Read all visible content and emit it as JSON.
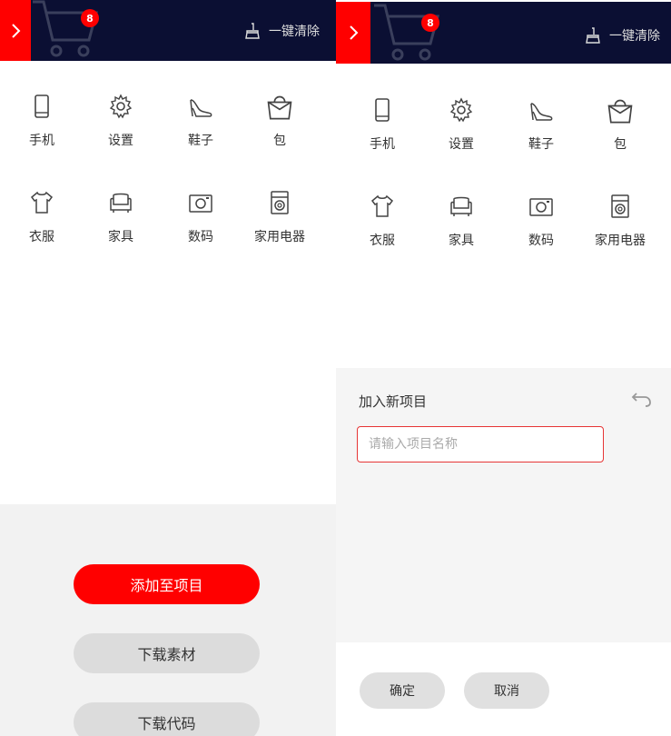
{
  "header": {
    "cart_count": "8",
    "clear_label": "一键清除"
  },
  "categories": [
    {
      "label": "手机",
      "icon": "phone-icon"
    },
    {
      "label": "设置",
      "icon": "gear-icon"
    },
    {
      "label": "鞋子",
      "icon": "shoe-icon"
    },
    {
      "label": "包",
      "icon": "bag-icon"
    },
    {
      "label": "衣服",
      "icon": "shirt-icon"
    },
    {
      "label": "家具",
      "icon": "sofa-icon"
    },
    {
      "label": "数码",
      "icon": "camera-icon"
    },
    {
      "label": "家用电器",
      "icon": "washing-machine-icon"
    }
  ],
  "actions": {
    "add_to_project": "添加至项目",
    "download_assets": "下载素材",
    "download_code": "下载代码"
  },
  "new_project": {
    "title": "加入新项目",
    "input_placeholder": "请输入项目名称",
    "input_value": "",
    "confirm": "确定",
    "cancel": "取消"
  },
  "colors": {
    "accent": "#ff0000",
    "header_bg": "#0b0f33"
  }
}
